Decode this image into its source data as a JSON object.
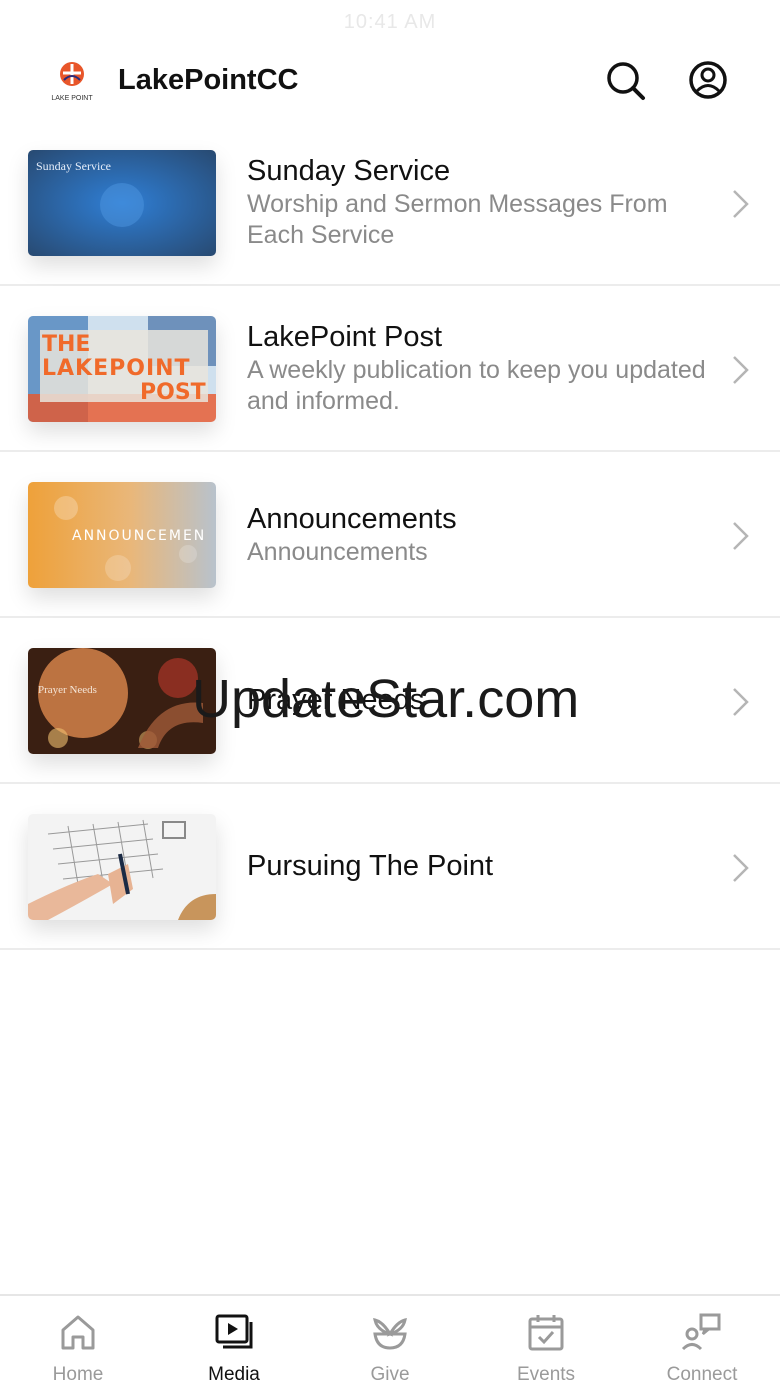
{
  "status_bar": {
    "time": "10:41 AM"
  },
  "header": {
    "title": "LakePointCC",
    "logo_text": "LAKE POINT"
  },
  "media_items": [
    {
      "title": "Sunday Service",
      "subtitle": "Worship and Sermon Messages From Each Service",
      "thumb_text": "Sunday Service"
    },
    {
      "title": "LakePoint Post",
      "subtitle": "A weekly publication to keep you updated and informed.",
      "thumb_text": [
        "THE",
        "LAKEPOINT",
        "POST"
      ]
    },
    {
      "title": "Announcements",
      "subtitle": "Announcements",
      "thumb_text": "ANNOUNCEMEN"
    },
    {
      "title": "Prayer Needs",
      "subtitle": "",
      "thumb_text": "Prayer Needs"
    },
    {
      "title": "Pursuing The Point",
      "subtitle": ""
    }
  ],
  "watermark": "UpdateStar.com",
  "tabs": [
    {
      "label": "Home",
      "icon": "home-icon",
      "active": false
    },
    {
      "label": "Media",
      "icon": "media-icon",
      "active": true
    },
    {
      "label": "Give",
      "icon": "give-icon",
      "active": false
    },
    {
      "label": "Events",
      "icon": "events-icon",
      "active": false
    },
    {
      "label": "Connect",
      "icon": "connect-icon",
      "active": false
    }
  ],
  "colors": {
    "active": "#111111",
    "inactive": "#9a9a9a",
    "divider": "#ececec",
    "accent": "#e8562a"
  }
}
